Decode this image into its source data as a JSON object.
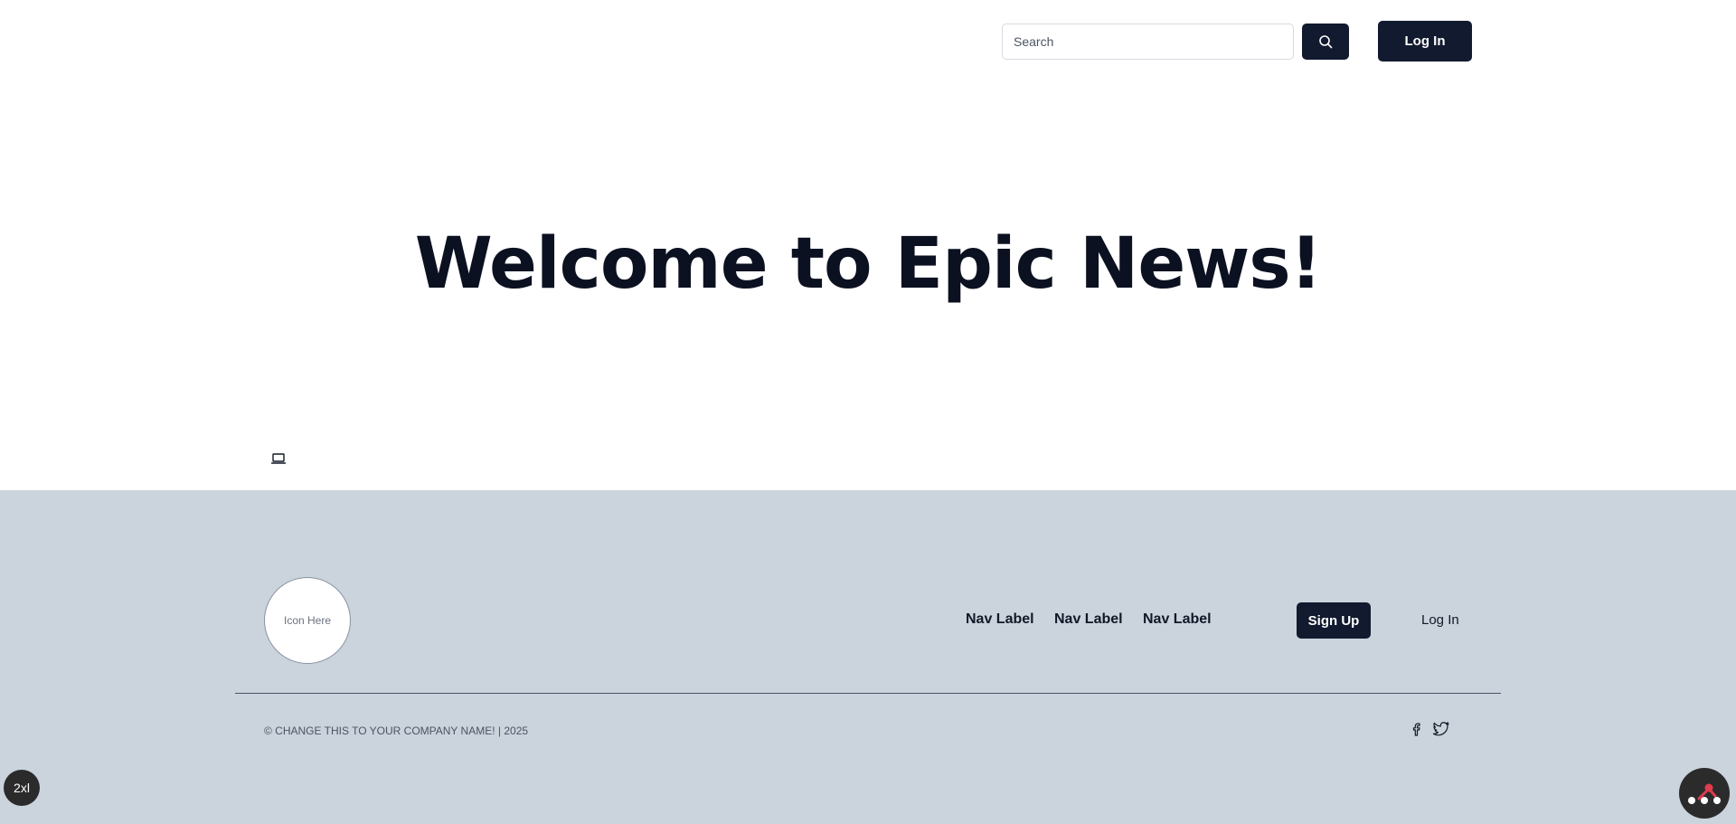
{
  "header": {
    "search": {
      "placeholder": "Search",
      "value": "",
      "icon": "search-icon"
    },
    "login_label": "Log In"
  },
  "hero": {
    "title": "Welcome to Epic News!"
  },
  "footer": {
    "logo_label": "Icon Here",
    "nav": [
      "Nav Label",
      "Nav Label",
      "Nav Label"
    ],
    "signup_label": "Sign Up",
    "login_label": "Log In",
    "copyright": "© CHANGE THIS TO YOUR COMPANY NAME! | 2025",
    "social_icons": [
      "facebook-icon",
      "twitter-icon"
    ]
  },
  "overlay": {
    "breakpoint": "2xl",
    "devtools_icon": "devtools-icon"
  },
  "colors": {
    "primary": "#111a2e",
    "footer_bg": "#cbd3dd",
    "title": "#0b1120",
    "accent_red": "#e23b4e"
  }
}
